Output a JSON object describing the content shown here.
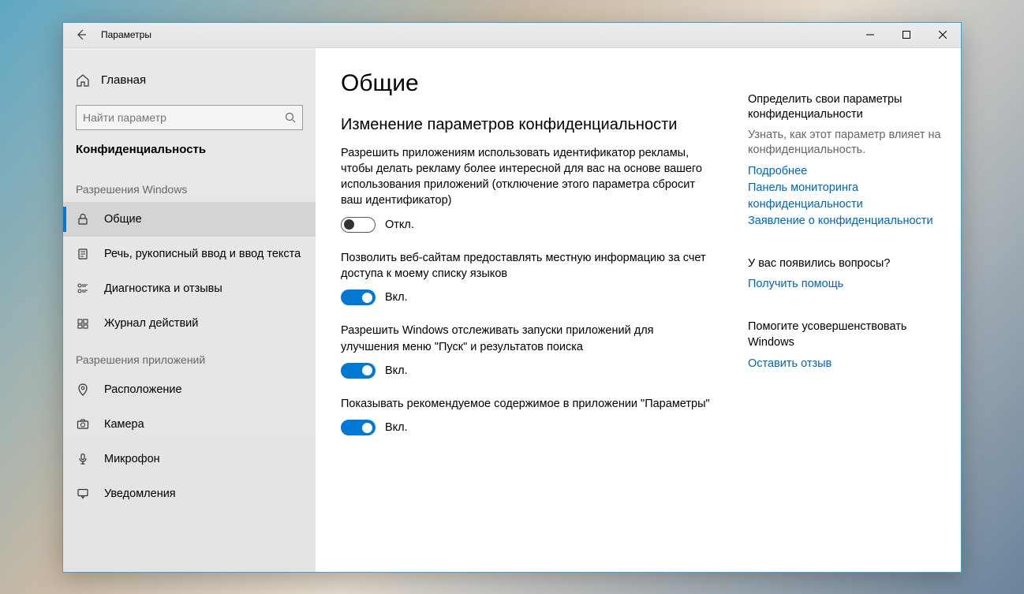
{
  "window": {
    "title": "Параметры"
  },
  "sidebar": {
    "home": "Главная",
    "search_placeholder": "Найти параметр",
    "category": "Конфиденциальность",
    "group1": "Разрешения Windows",
    "items1": [
      {
        "label": "Общие"
      },
      {
        "label": "Речь, рукописный ввод и ввод текста"
      },
      {
        "label": "Диагностика и отзывы"
      },
      {
        "label": "Журнал действий"
      }
    ],
    "group2": "Разрешения приложений",
    "items2": [
      {
        "label": "Расположение"
      },
      {
        "label": "Камера"
      },
      {
        "label": "Микрофон"
      },
      {
        "label": "Уведомления"
      }
    ]
  },
  "main": {
    "h1": "Общие",
    "h2": "Изменение параметров конфиденциальности",
    "settings": [
      {
        "desc": "Разрешить приложениям использовать идентификатор рекламы, чтобы делать рекламу более интересной для вас на основе вашего использования приложений (отключение этого параметра сбросит ваш идентификатор)",
        "on": false
      },
      {
        "desc": "Позволить веб-сайтам предоставлять местную информацию за счет доступа к моему списку языков",
        "on": true
      },
      {
        "desc": "Разрешить Windows отслеживать запуски приложений для улучшения меню \"Пуск\" и результатов поиска",
        "on": true
      },
      {
        "desc": "Показывать рекомендуемое содержимое в приложении \"Параметры\"",
        "on": true
      }
    ],
    "labels": {
      "on": "Вкл.",
      "off": "Откл."
    }
  },
  "right": {
    "block1": {
      "title": "Определить свои параметры конфиденциальности",
      "muted": "Узнать, как этот параметр влияет на конфиденциальность.",
      "links": [
        "Подробнее",
        "Панель мониторинга конфиденциальности",
        "Заявление о конфиденциальности"
      ]
    },
    "block2": {
      "title": "У вас появились вопросы?",
      "links": [
        "Получить помощь"
      ]
    },
    "block3": {
      "title": "Помогите усовершенствовать Windows",
      "links": [
        "Оставить отзыв"
      ]
    }
  }
}
